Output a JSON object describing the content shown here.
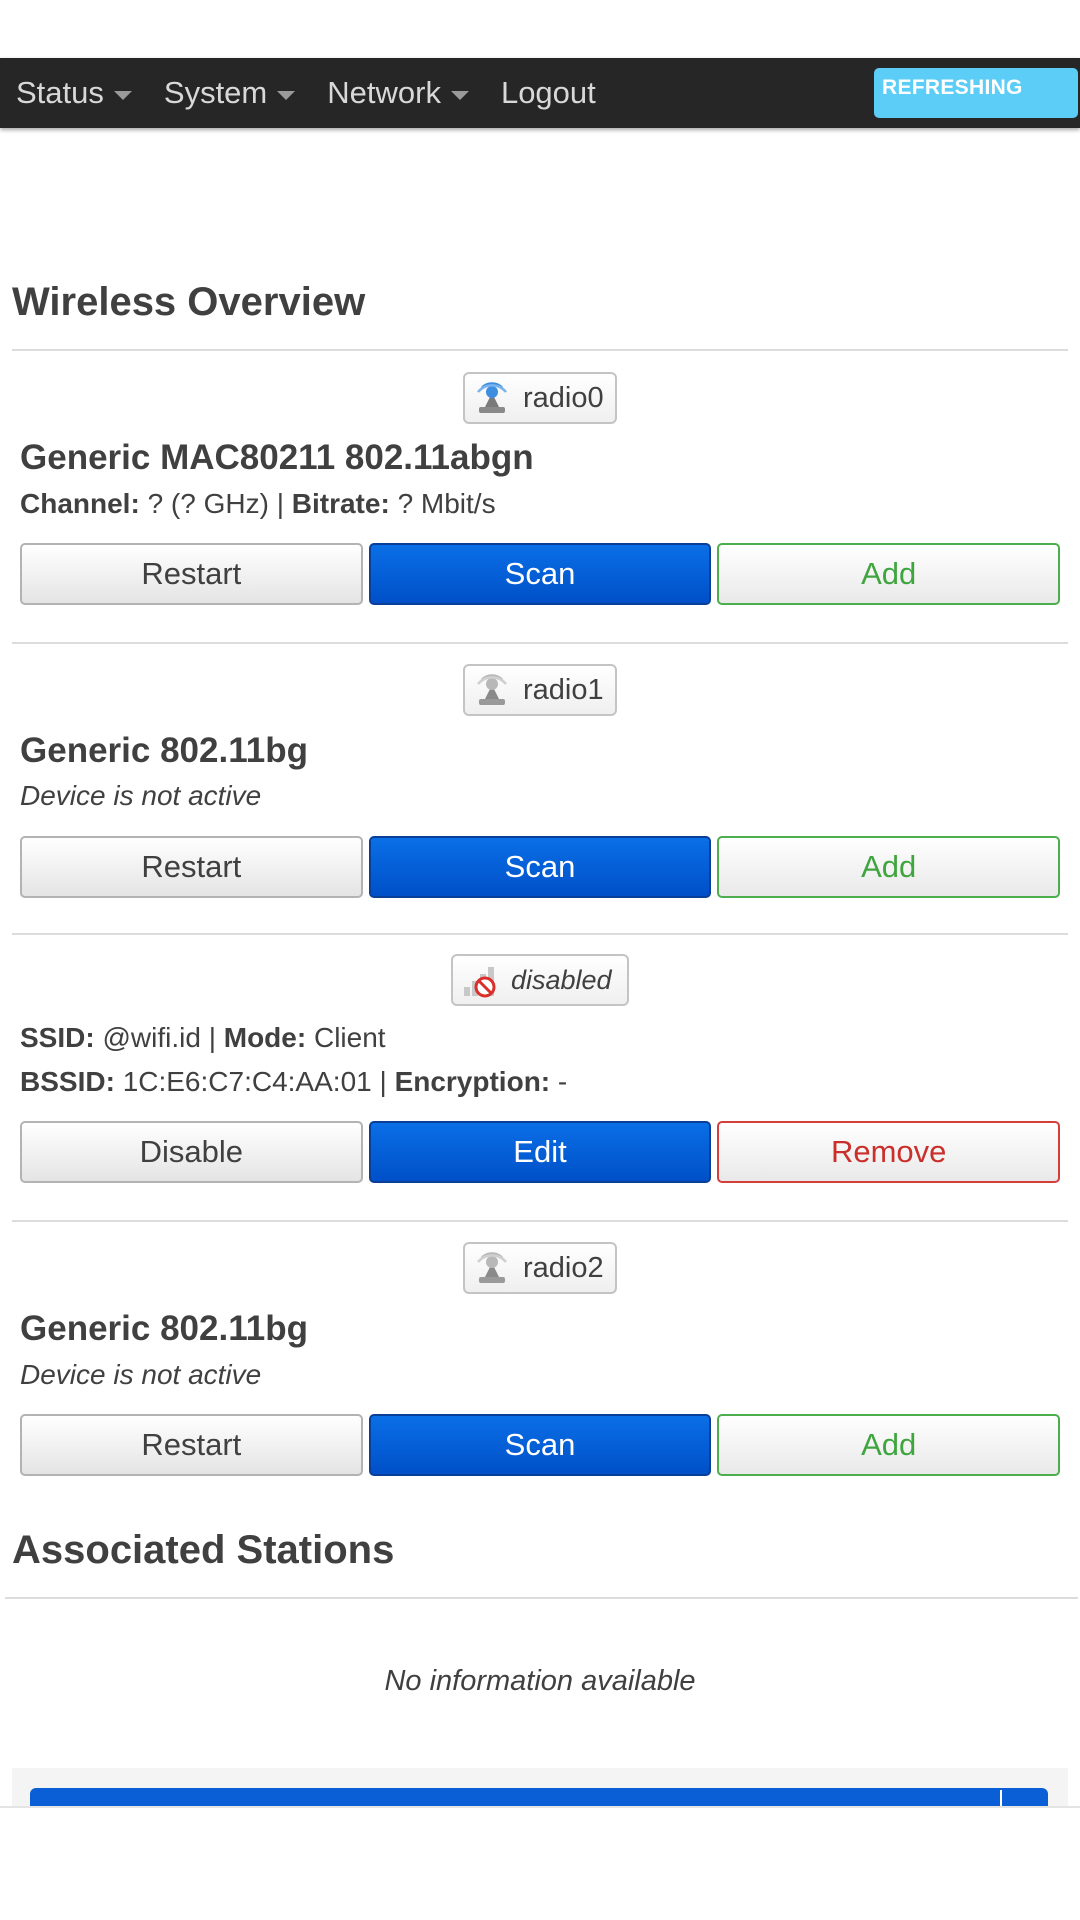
{
  "nav": {
    "items": [
      {
        "label": "Status",
        "dropdown": true
      },
      {
        "label": "System",
        "dropdown": true
      },
      {
        "label": "Network",
        "dropdown": true
      },
      {
        "label": "Logout",
        "dropdown": false
      }
    ],
    "refresh_badge": "REFRESHING"
  },
  "wireless": {
    "title": "Wireless Overview",
    "radio0": {
      "badge": "radio0",
      "name": "Generic MAC80211 802.11abgn",
      "channel_label": "Channel:",
      "channel_value": "? (? GHz)",
      "separator": "|",
      "bitrate_label": "Bitrate:",
      "bitrate_value": "? Mbit/s",
      "buttons": {
        "restart": "Restart",
        "scan": "Scan",
        "add": "Add"
      }
    },
    "radio1": {
      "badge": "radio1",
      "name": "Generic 802.11bg",
      "status": "Device is not active",
      "buttons": {
        "restart": "Restart",
        "scan": "Scan",
        "add": "Add"
      }
    },
    "network": {
      "badge": "disabled",
      "ssid_label": "SSID:",
      "ssid_value": "@wifi.id",
      "separator": "|",
      "mode_label": "Mode:",
      "mode_value": "Client",
      "bssid_label": "BSSID:",
      "bssid_value": "1C:E6:C7:C4:AA:01",
      "encryption_label": "Encryption:",
      "encryption_value": "-",
      "buttons": {
        "disable": "Disable",
        "edit": "Edit",
        "remove": "Remove"
      }
    },
    "radio2": {
      "badge": "radio2",
      "name": "Generic 802.11bg",
      "status": "Device is not active",
      "buttons": {
        "restart": "Restart",
        "scan": "Scan",
        "add": "Add"
      }
    }
  },
  "stations": {
    "title": "Associated Stations",
    "empty": "No information available"
  },
  "colors": {
    "navbar": "#262626",
    "refresh_badge": "#5ccdf7",
    "primary": "#0050c8",
    "add": "#4cae4c",
    "remove": "#d43f3a"
  },
  "icons": [
    "wifi-radio-active-icon",
    "wifi-radio-inactive-icon",
    "signal-disabled-icon",
    "caret-down-icon"
  ]
}
